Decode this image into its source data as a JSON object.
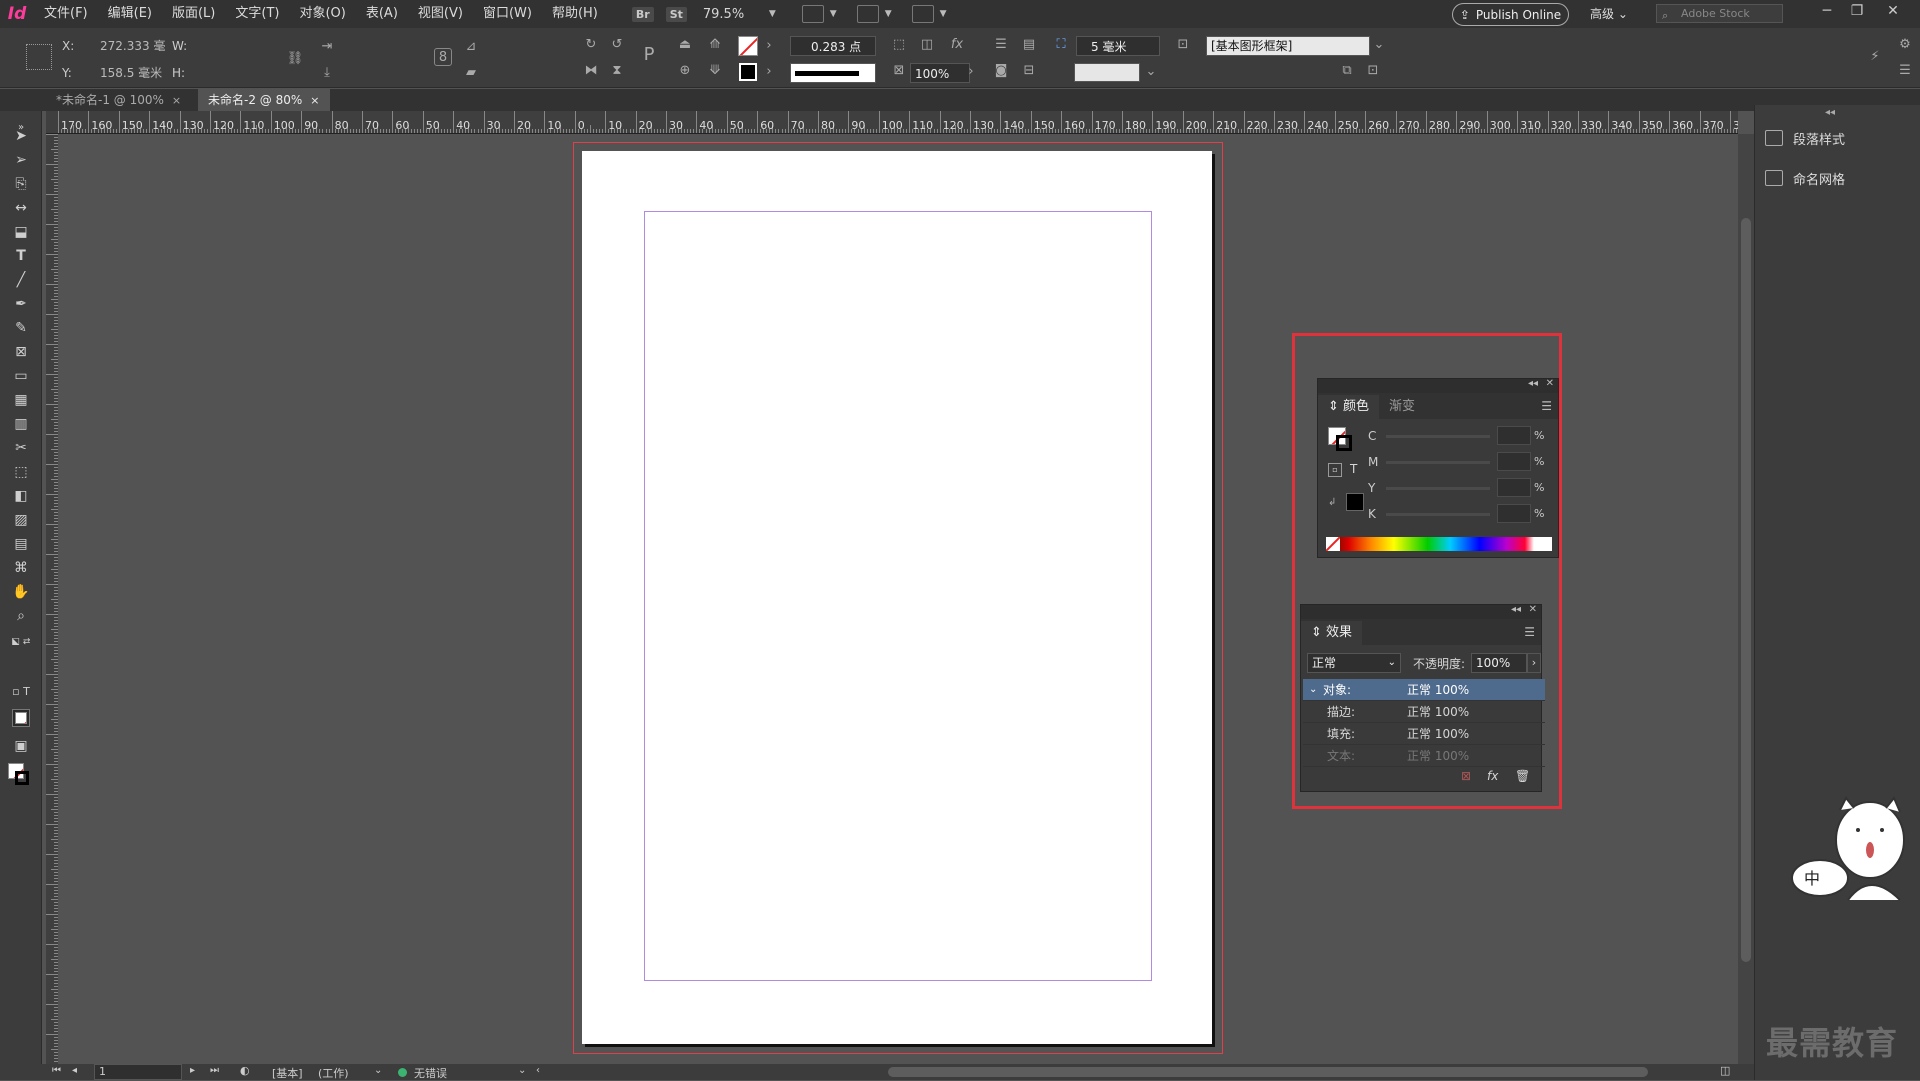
{
  "app": {
    "logo": "Id"
  },
  "menu": {
    "items": [
      "文件(F)",
      "编辑(E)",
      "版面(L)",
      "文字(T)",
      "对象(O)",
      "表(A)",
      "视图(V)",
      "窗口(W)",
      "帮助(H)"
    ],
    "bridge": "Br",
    "stock": "St",
    "zoom": "79.5%",
    "publish": "Publish Online",
    "workspace": "高级",
    "search_placeholder": "Adobe Stock"
  },
  "control": {
    "x_label": "X:",
    "x_value": "272.333 毫",
    "y_label": "Y:",
    "y_value": "158.5 毫米",
    "w_label": "W:",
    "h_label": "H:",
    "stroke_weight": "0.283 点",
    "opacity": "100%",
    "gap": "5 毫米",
    "frame_style": "[基本图形框架]"
  },
  "tabs": [
    {
      "label": "*未命名-1 @ 100%",
      "close": "×"
    },
    {
      "label": "未命名-2 @ 80%",
      "close": "×"
    }
  ],
  "ruler": {
    "h_labels": [
      "170",
      "160",
      "150",
      "140",
      "130",
      "120",
      "110",
      "100",
      "90",
      "80",
      "70",
      "60",
      "50",
      "40",
      "30",
      "20",
      "10",
      "0",
      "10",
      "20",
      "30",
      "40",
      "50",
      "60",
      "70",
      "80",
      "90",
      "100",
      "110",
      "120",
      "130",
      "140",
      "150",
      "160",
      "170",
      "180",
      "190",
      "200",
      "210",
      "220",
      "230",
      "240",
      "250",
      "260",
      "270",
      "280",
      "290",
      "300",
      "310",
      "320",
      "330",
      "340",
      "350",
      "360",
      "370",
      "38"
    ]
  },
  "dock": {
    "items": [
      "段落样式",
      "命名网格"
    ]
  },
  "color_panel": {
    "tabs": [
      "颜色",
      "渐变"
    ],
    "channels": [
      "C",
      "M",
      "Y",
      "K"
    ],
    "pct": "%",
    "text_toggle": "T"
  },
  "effects_panel": {
    "tab": "效果",
    "blend_mode": "正常",
    "opacity_label": "不透明度:",
    "opacity_value": "100%",
    "rows": [
      {
        "name": "对象:",
        "value": "正常 100%"
      },
      {
        "name": "描边:",
        "value": "正常 100%"
      },
      {
        "name": "填充:",
        "value": "正常 100%"
      },
      {
        "name": "文本:",
        "value": "正常 100%"
      }
    ]
  },
  "status": {
    "page": "1",
    "profile": "[基本]",
    "mode": "(工作)",
    "preflight": "无错误"
  },
  "watermark": "最需教育",
  "mascot_text": "中",
  "colors": {
    "accent_highlight": "#e0323a",
    "margin_guide": "#b28be0",
    "selected_row": "#4e6a8c",
    "preflight_ok": "#3cb371"
  }
}
